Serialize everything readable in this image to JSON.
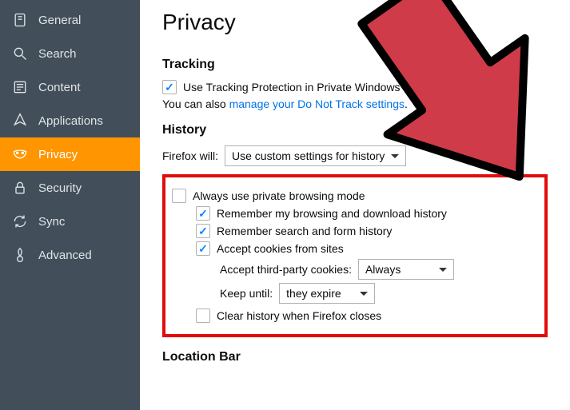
{
  "sidebar": {
    "items": [
      {
        "label": "General"
      },
      {
        "label": "Search"
      },
      {
        "label": "Content"
      },
      {
        "label": "Applications"
      },
      {
        "label": "Privacy"
      },
      {
        "label": "Security"
      },
      {
        "label": "Sync"
      },
      {
        "label": "Advanced"
      }
    ]
  },
  "page": {
    "title": "Privacy"
  },
  "tracking": {
    "heading": "Tracking",
    "checkbox_label": "Use Tracking Protection in Private Windows",
    "subtext_prefix": "You can also ",
    "subtext_link": "manage your Do Not Track settings"
  },
  "history": {
    "heading": "History",
    "will_label": "Firefox will:",
    "will_value": "Use custom settings for history",
    "always_private": "Always use private browsing mode",
    "remember_browsing": "Remember my browsing and download history",
    "remember_search": "Remember search and form history",
    "accept_cookies": "Accept cookies from sites",
    "third_party_label": "Accept third-party cookies:",
    "third_party_value": "Always",
    "keep_until_label": "Keep until:",
    "keep_until_value": "they expire",
    "clear_on_close": "Clear history when Firefox closes"
  },
  "locationbar": {
    "heading": "Location Bar"
  }
}
